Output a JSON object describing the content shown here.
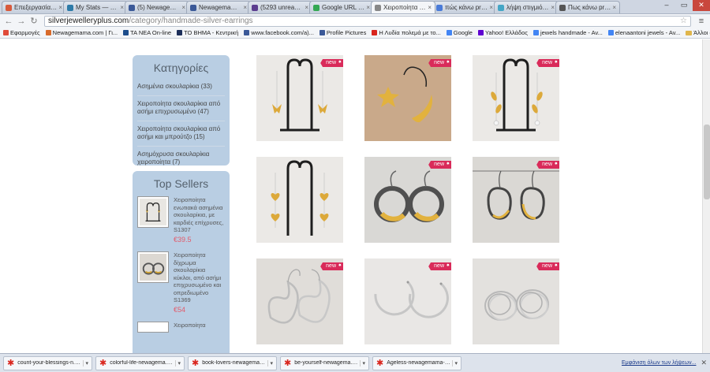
{
  "browser": {
    "tabs": [
      {
        "title": "Επεξεργασία άρθρο",
        "color": "#d85a3c"
      },
      {
        "title": "My Stats — WordPr",
        "color": "#2e7ba8"
      },
      {
        "title": "(5) Newagemama",
        "color": "#3b5998"
      },
      {
        "title": "Newagemama - fee",
        "color": "#3b5998"
      },
      {
        "title": "(5293 unread) - nw",
        "color": "#5b3d8f"
      },
      {
        "title": "Google URL Shorte",
        "color": "#34a853"
      },
      {
        "title": "Χειροποίητα σκουλ",
        "color": "#888888",
        "active": true
      },
      {
        "title": "πώς κάνω print sc",
        "color": "#4a7bd8"
      },
      {
        "title": "λήψη στιγμιότυπο",
        "color": "#45a6c6"
      },
      {
        "title": "Πως κάνω print sc",
        "color": "#555555"
      }
    ],
    "url_domain": "silverjewelleryplus.com",
    "url_path": "/category/handmade-silver-earrings",
    "bookmarks": [
      {
        "label": "Εφαρμογές",
        "color": "#e04b3a"
      },
      {
        "label": "Newagemama.com | Γι...",
        "color": "#d86a2a"
      },
      {
        "label": "ΤΑ ΝΕΑ On-line",
        "color": "#1c4d8c"
      },
      {
        "label": "ΤΟ ΒΗΜΑ - Κεντρική",
        "color": "#1c2e5a"
      },
      {
        "label": "www.facebook.com/a)...",
        "color": "#3b5998"
      },
      {
        "label": "Profile Pictures",
        "color": "#3b5998"
      },
      {
        "label": "Η Λυδία πολεμά με το...",
        "color": "#d9251d"
      },
      {
        "label": "Google",
        "color": "#4285f4"
      },
      {
        "label": "Yahoo! Ελλάδος",
        "color": "#5f01d1"
      },
      {
        "label": "jewels handmade - Av...",
        "color": "#4285f4"
      },
      {
        "label": "elenaantoni jewels - Av...",
        "color": "#4285f4"
      }
    ],
    "other_bookmarks": "Άλλοι σελιδοδείκτες"
  },
  "sidebar": {
    "categories_title": "Κατηγορίες",
    "categories": [
      "Ασημένια σκουλαρίκια (33)",
      "Χειροποίητα σκουλαρίκια από ασήμι επιχρυσωμένο (47)",
      "Χειροποίητα σκουλαρίκια από ασήμι και μπρούτζο (15)",
      "Ασημόχρυσα σκουλαρίκια χειροποίητα (7)"
    ],
    "top_sellers_title": "Top Sellers",
    "top_sellers": [
      {
        "name": "Χειροποίητα ενωτιακά ασημένια σκουλαρίκια, με καρδιές επίχρυσες, S1307",
        "price": "€39.5"
      },
      {
        "name": "Χειροποίητα δίχρωμα σκουλαρίκια κύκλοι, από ασήμι επιχρυσωμένο και οπρεδιωμένο S1369",
        "price": "€54"
      },
      {
        "name": "Χειροποίητα",
        "price": ""
      }
    ]
  },
  "products": {
    "badge": "new",
    "items": [
      {
        "name": "butterfly-drop-earrings"
      },
      {
        "name": "star-moon-earrings"
      },
      {
        "name": "leaf-drop-earrings"
      },
      {
        "name": "heart-drop-earrings"
      },
      {
        "name": "two-tone-ring-earrings-1"
      },
      {
        "name": "two-tone-ring-earrings-2"
      },
      {
        "name": "silver-heart-hooks"
      },
      {
        "name": "silver-hoop-earrings"
      },
      {
        "name": "silver-wire-loop-earrings"
      }
    ]
  },
  "downloads": {
    "items": [
      "count-your-blessings-n....jpg",
      "colorful-life-newagema....jpg",
      "book-lovers-newagema....jpg",
      "be-yourself-newagema....jpg",
      "Ageless-newagemama-....jpg"
    ],
    "show_all": "Εμφάνιση όλων των λήψεων..."
  }
}
